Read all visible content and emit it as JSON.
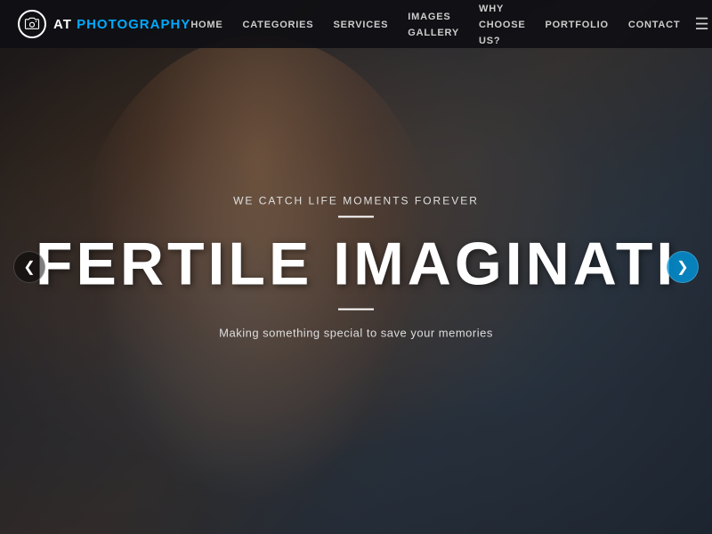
{
  "logo": {
    "at": "AT",
    "photography": "PHOTOGRAPHY"
  },
  "nav": {
    "links": [
      {
        "id": "home",
        "label": "HOME"
      },
      {
        "id": "categories",
        "label": "CATEGORIES"
      },
      {
        "id": "services",
        "label": "SERVICES"
      },
      {
        "id": "images-gallery",
        "label": "IMAGES GALLERY"
      },
      {
        "id": "why-choose-us",
        "label": "WHY CHOOSE US?"
      },
      {
        "id": "portfolio",
        "label": "PORTFOLIO"
      },
      {
        "id": "contact",
        "label": "CONTACT"
      }
    ],
    "hamburger": "☰"
  },
  "hero": {
    "tagline": "WE CATCH LIFE MOMENTS FOREVER",
    "title": "FERTILE IMAGINATIO",
    "subtitle": "Making something special to save your memories",
    "arrow_left": "❮",
    "arrow_right": "❯"
  }
}
